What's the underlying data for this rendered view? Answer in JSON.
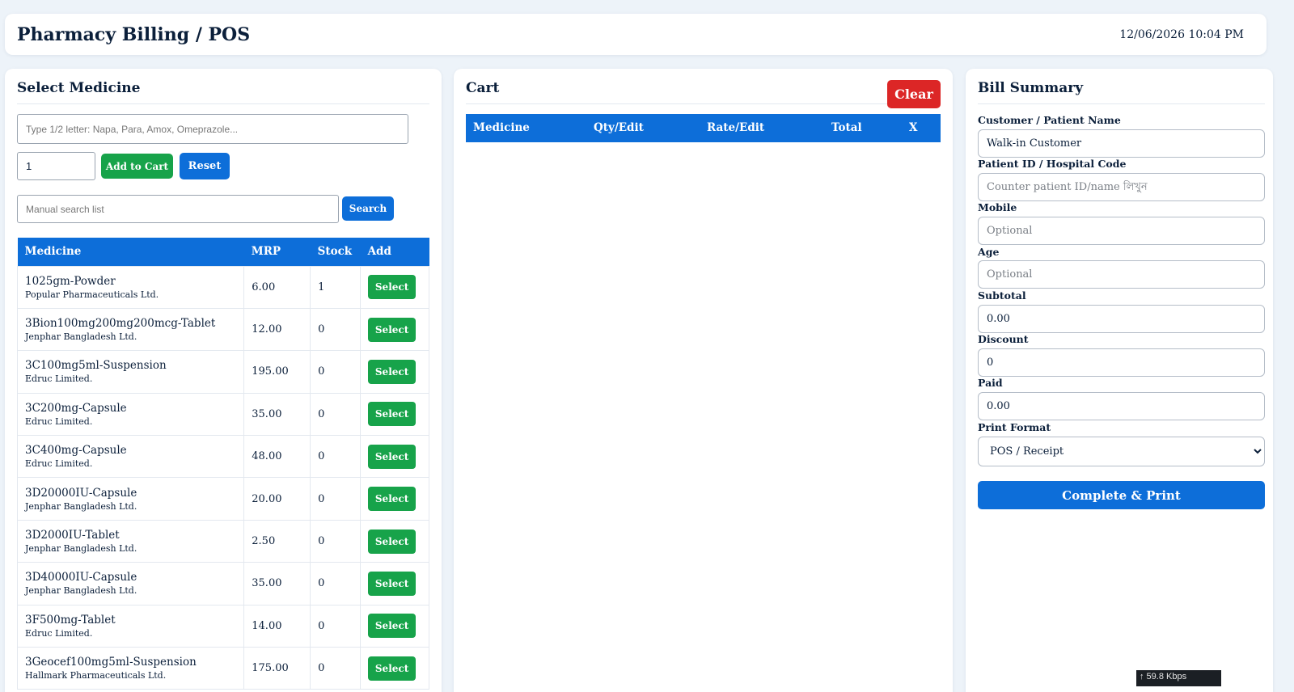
{
  "header": {
    "title": "Pharmacy Billing / POS",
    "datetime": "12/06/2026 10:04 PM"
  },
  "select_medicine": {
    "title": "Select Medicine",
    "search_placeholder": "Type 1/2 letter: Napa, Para, Amox, Omeprazole...",
    "qty_value": "1",
    "add_to_cart_label": "Add to Cart",
    "reset_label": "Reset",
    "manual_search_placeholder": "Manual search list",
    "search_label": "Search",
    "table_headers": [
      "Medicine",
      "MRP",
      "Stock",
      "Add"
    ],
    "select_label": "Select",
    "medicines": [
      {
        "name": "1025gm-Powder",
        "mfr": "Popular Pharmaceuticals Ltd.",
        "mrp": "6.00",
        "stock": "1"
      },
      {
        "name": "3Bion100mg200mg200mcg-Tablet",
        "mfr": "Jenphar Bangladesh Ltd.",
        "mrp": "12.00",
        "stock": "0"
      },
      {
        "name": "3C100mg5ml-Suspension",
        "mfr": "Edruc Limited.",
        "mrp": "195.00",
        "stock": "0"
      },
      {
        "name": "3C200mg-Capsule",
        "mfr": "Edruc Limited.",
        "mrp": "35.00",
        "stock": "0"
      },
      {
        "name": "3C400mg-Capsule",
        "mfr": "Edruc Limited.",
        "mrp": "48.00",
        "stock": "0"
      },
      {
        "name": "3D20000IU-Capsule",
        "mfr": "Jenphar Bangladesh Ltd.",
        "mrp": "20.00",
        "stock": "0"
      },
      {
        "name": "3D2000IU-Tablet",
        "mfr": "Jenphar Bangladesh Ltd.",
        "mrp": "2.50",
        "stock": "0"
      },
      {
        "name": "3D40000IU-Capsule",
        "mfr": "Jenphar Bangladesh Ltd.",
        "mrp": "35.00",
        "stock": "0"
      },
      {
        "name": "3F500mg-Tablet",
        "mfr": "Edruc Limited.",
        "mrp": "14.00",
        "stock": "0"
      },
      {
        "name": "3Geocef100mg5ml-Suspension",
        "mfr": "Hallmark Pharmaceuticals Ltd.",
        "mrp": "175.00",
        "stock": "0"
      }
    ]
  },
  "cart": {
    "title": "Cart",
    "clear_label": "Clear",
    "headers": [
      "Medicine",
      "Qty/Edit",
      "Rate/Edit",
      "Total",
      "X"
    ]
  },
  "bill_summary": {
    "title": "Bill Summary",
    "customer_label": "Customer / Patient Name",
    "customer_value": "Walk-in Customer",
    "patient_id_label": "Patient ID / Hospital Code",
    "patient_id_placeholder": "Counter patient ID/name লিখুন",
    "mobile_label": "Mobile",
    "mobile_placeholder": "Optional",
    "age_label": "Age",
    "age_placeholder": "Optional",
    "subtotal_label": "Subtotal",
    "subtotal_value": "0.00",
    "discount_label": "Discount",
    "discount_value": "0",
    "paid_label": "Paid",
    "paid_value": "0.00",
    "print_format_label": "Print Format",
    "print_format_value": "POS / Receipt",
    "complete_label": "Complete & Print"
  },
  "network_speed": "↑ 59.8 Kbps",
  "colors": {
    "primary": "#0d6ed9",
    "success": "#17a34a",
    "danger": "#dc2626",
    "text": "#0b1f3a",
    "background": "#edf3f9"
  }
}
